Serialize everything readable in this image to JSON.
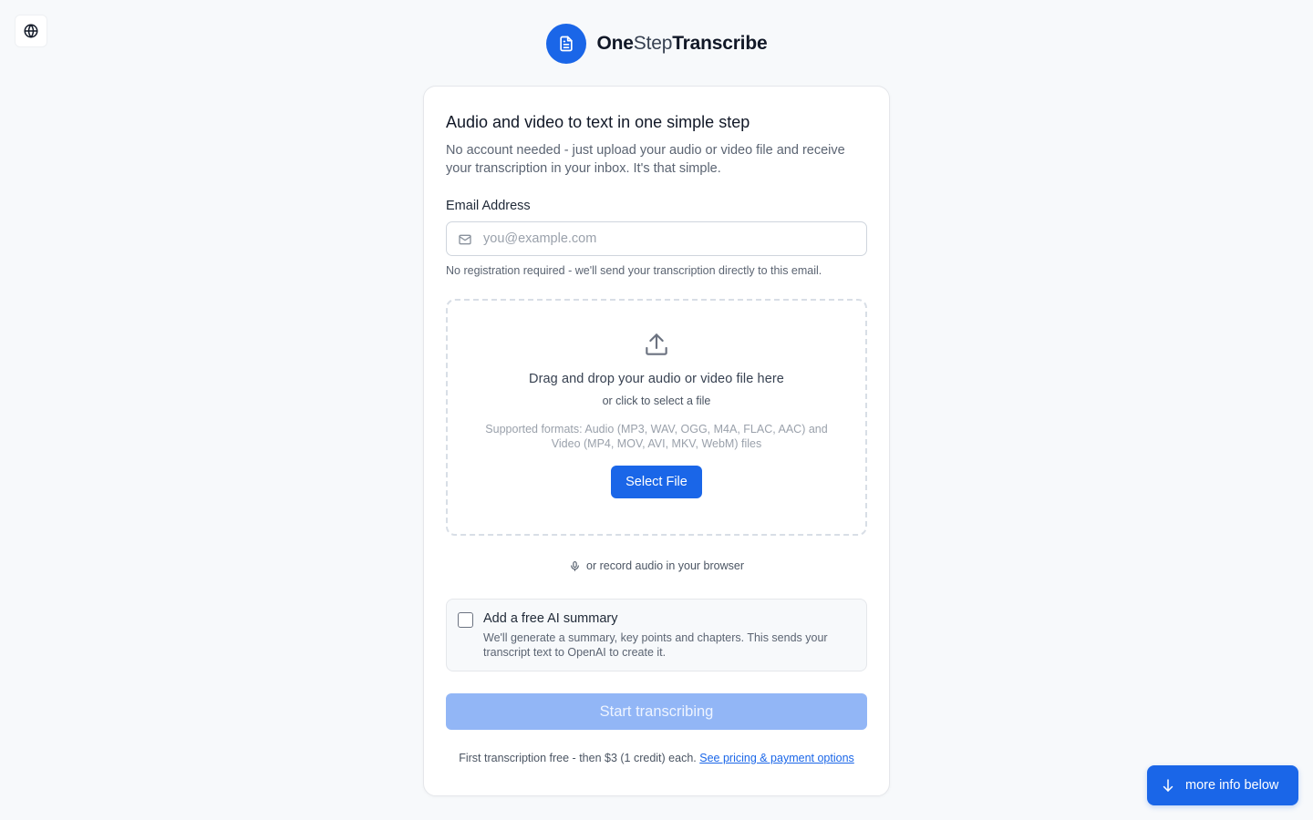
{
  "brand": {
    "name_part1": "One",
    "name_part2": "Step",
    "name_part3": "Transcribe"
  },
  "card": {
    "title": "Audio and video to text in one simple step",
    "lead": "No account needed - just upload your audio or video file and receive your transcription in your inbox. It's that simple.",
    "email": {
      "label": "Email Address",
      "placeholder": "you@example.com",
      "value": "",
      "hint": "No registration required - we'll send your transcription directly to this email."
    },
    "dropzone": {
      "title": "Drag and drop your audio or video file here",
      "subtitle": "or click to select a file",
      "formats": "Supported formats: Audio (MP3, WAV, OGG, M4A, FLAC, AAC) and Video (MP4, MOV, AVI, MKV, WebM) files",
      "button_label": "Select File"
    },
    "record_label": "or record audio in your browser",
    "summary": {
      "title": "Add a free AI summary",
      "description": "We'll generate a summary, key points and chapters. This sends your transcript text to OpenAI to create it.",
      "checked": false
    },
    "start_button_label": "Start transcribing",
    "footnote_text": "First transcription free - then $3 (1 credit) each.",
    "footnote_link": "See pricing & payment options"
  },
  "more_info_label": "more info below",
  "icons": {
    "language": "globe-icon",
    "logo": "document-icon",
    "email": "mail-icon",
    "upload": "upload-icon",
    "record": "microphone-icon",
    "more_info": "arrow-down-icon"
  },
  "colors": {
    "accent": "#1a66e8",
    "accent_disabled": "#92b6f6",
    "background": "#f7f9fb"
  }
}
